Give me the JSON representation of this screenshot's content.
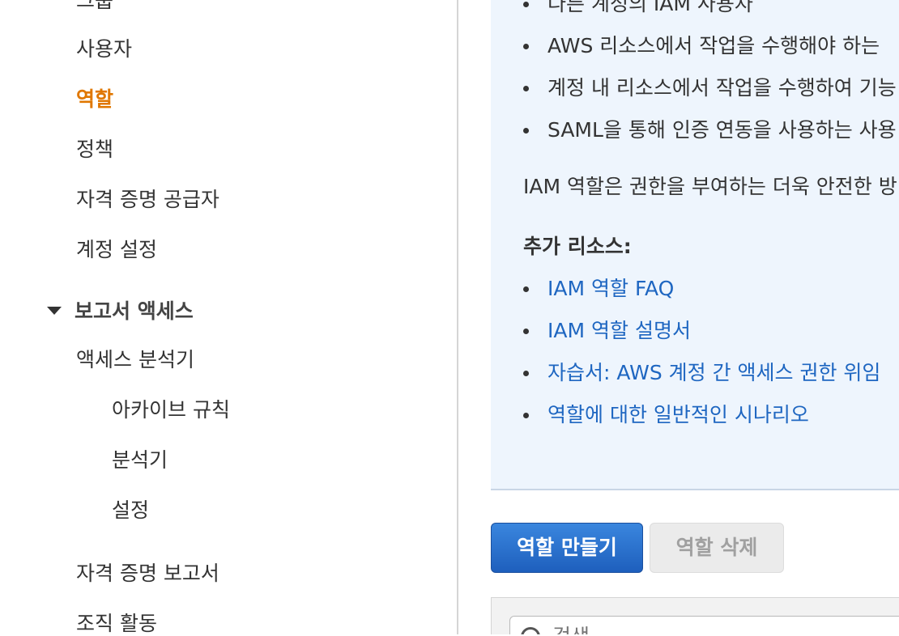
{
  "sidebar": {
    "groups_label": "그룹",
    "items": [
      {
        "label": "사용자"
      },
      {
        "label": "역할",
        "active": true
      },
      {
        "label": "정책"
      },
      {
        "label": "자격 증명 공급자"
      },
      {
        "label": "계정 설정"
      }
    ],
    "report_access": {
      "label": "보고서 액세스",
      "items": [
        {
          "label": "액세스 분석기"
        },
        {
          "label": "아카이브 규칙"
        },
        {
          "label": "분석기"
        },
        {
          "label": "설정"
        },
        {
          "label": "자격 증명 보고서"
        },
        {
          "label": "조직 활동"
        }
      ]
    },
    "active_color": "#e07700"
  },
  "info": {
    "bullets": [
      "다른 계정의 IAM 사용자",
      "AWS 리소스에서 작업을 수행해야 하는",
      "계정 내 리소스에서 작업을 수행하여 기능",
      "SAML을 통해 인증 연동을 사용하는 사용"
    ],
    "paragraph": "IAM 역할은 권한을 부여하는 더욱 안전한 방",
    "resources_heading": "추가 리소스:",
    "links": [
      "IAM 역할 FAQ",
      "IAM 역할 설명서",
      "자습서: AWS 계정 간 액세스 권한 위임",
      "역할에 대한 일반적인 시나리오"
    ],
    "link_color": "#1e66c1"
  },
  "actions": {
    "create_label": "역할 만들기",
    "delete_label": "역할 삭제"
  },
  "search": {
    "placeholder": "검색"
  }
}
